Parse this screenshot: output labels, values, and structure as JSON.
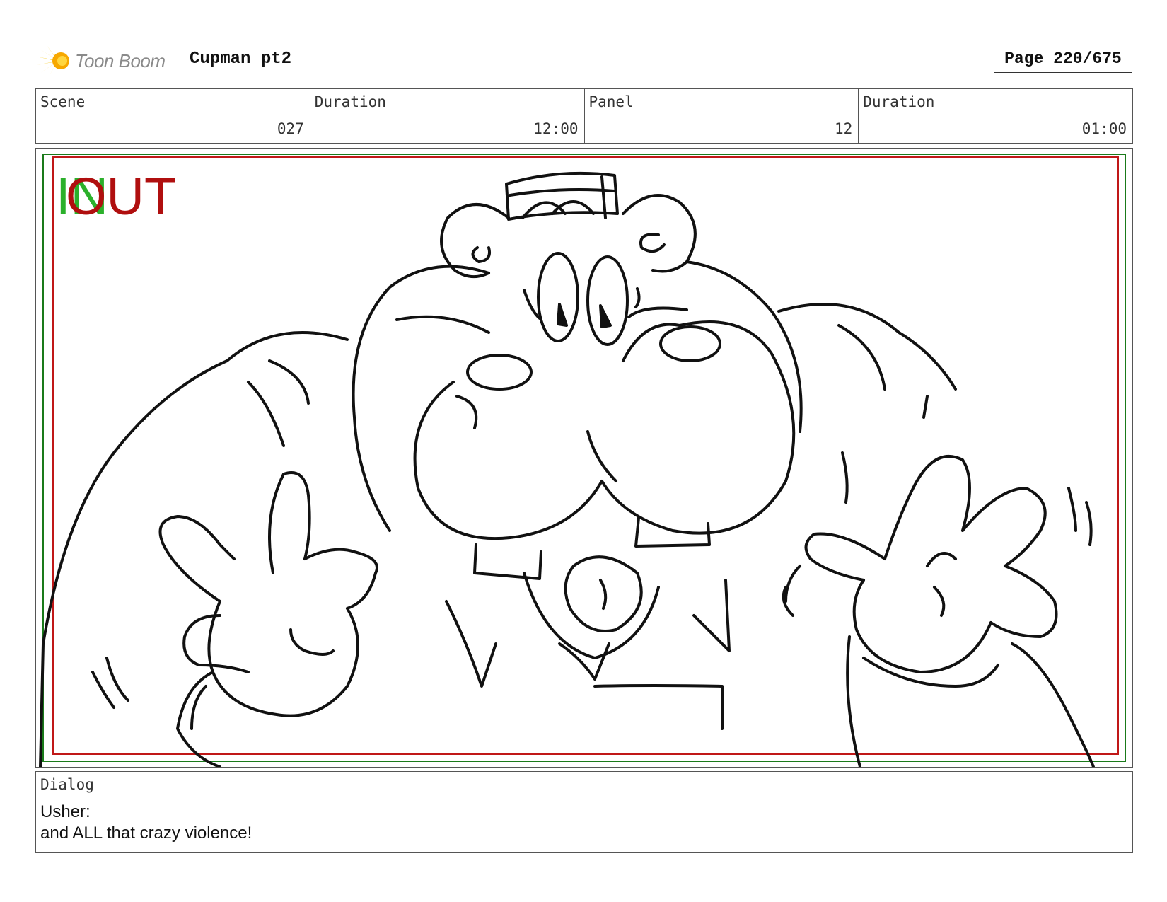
{
  "header": {
    "logo_text": "Toon Boom",
    "project_title": "Cupman pt2",
    "page_label": "Page 220/675"
  },
  "info": [
    {
      "label": "Scene",
      "value": "027"
    },
    {
      "label": "Duration",
      "value": "12:00"
    },
    {
      "label": "Panel",
      "value": "12"
    },
    {
      "label": "Duration",
      "value": "01:00"
    }
  ],
  "panel": {
    "in_marker": "IN",
    "out_marker": "OUT",
    "in_color": "#2bb02b",
    "out_color": "#b00f0f",
    "safe_frame_outer_color": "#1a7a1a",
    "safe_frame_inner_color": "#c01818"
  },
  "dialog": {
    "label": "Dialog",
    "speaker": "Usher:",
    "line": "and ALL that crazy violence!"
  }
}
